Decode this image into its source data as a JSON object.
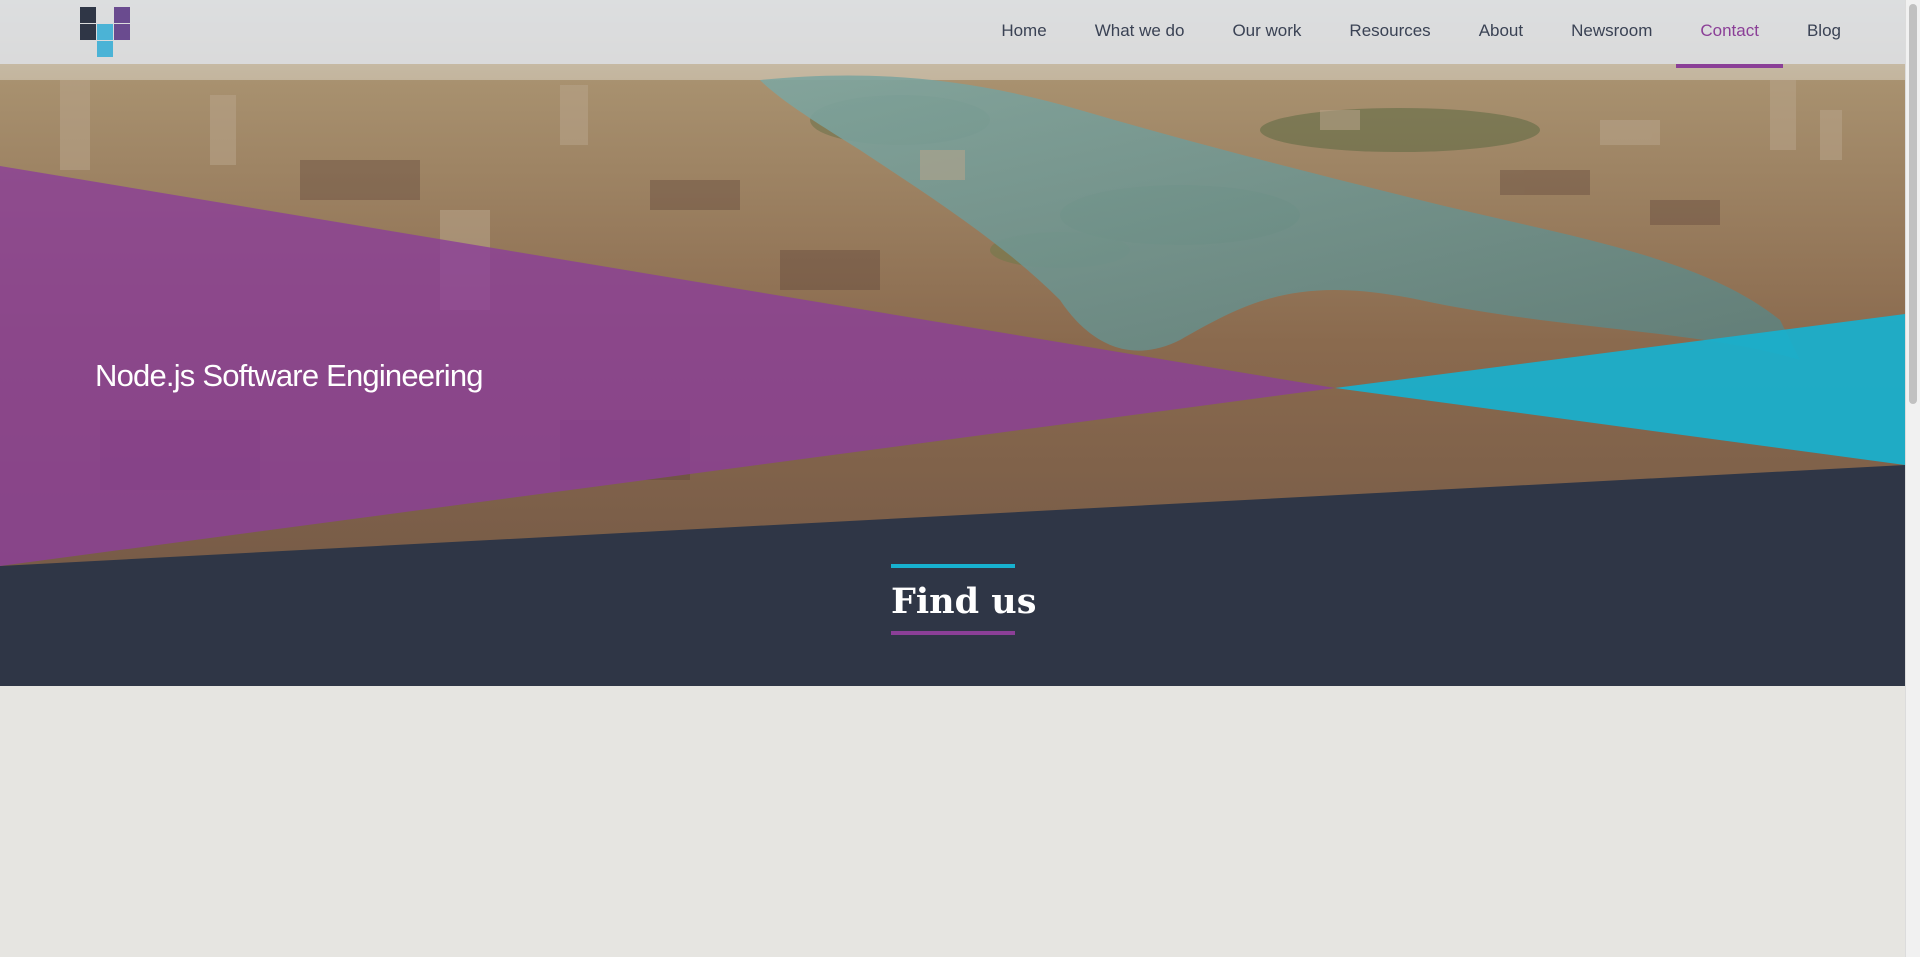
{
  "nav": {
    "items": [
      {
        "label": "Home",
        "active": false
      },
      {
        "label": "What we do",
        "active": false
      },
      {
        "label": "Our work",
        "active": false
      },
      {
        "label": "Resources",
        "active": false
      },
      {
        "label": "About",
        "active": false
      },
      {
        "label": "Newsroom",
        "active": false
      },
      {
        "label": "Contact",
        "active": true
      },
      {
        "label": "Blog",
        "active": false
      }
    ]
  },
  "hero": {
    "title": "Node.js Software Engineering"
  },
  "section": {
    "heading": "Find us"
  },
  "colors": {
    "accent_purple": "#8b3f97",
    "accent_cyan": "#17b1cf",
    "dark_navy": "#2f3646",
    "page_background": "#e6e5e1"
  },
  "icons": {
    "logo": "brand-logo-icon"
  }
}
